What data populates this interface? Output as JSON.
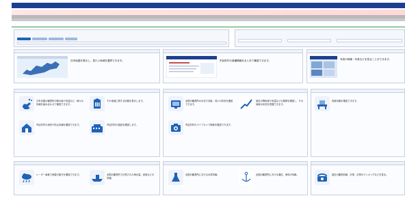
{
  "header": {
    "site_title": "",
    "alert_text": "",
    "band1_text": "",
    "band2_text": "",
    "section_title": ""
  },
  "search_panel": {
    "title": "",
    "tabs": [
      "",
      "",
      "",
      ""
    ]
  },
  "right_panel": {
    "title": "",
    "buttons": [
      "",
      "",
      ""
    ]
  },
  "thumbnails": [
    {
      "title": "",
      "desc": "日本地図を表示し、見たい地域を選択できます。"
    },
    {
      "title": "",
      "desc": "市区町村の各種情報をまとめて確認できます。"
    },
    {
      "title": "",
      "desc": "写真や映像・写真などを見ることができます。"
    }
  ],
  "main_section_label": "",
  "groups": [
    {
      "title": "",
      "cards": [
        {
          "icon": "hand-rain-icon",
          "title": "",
          "desc": "日本全国の観測所の降水量や気温など、様々な情報を組み合わせて確認できます。"
        },
        {
          "icon": "tower-icon",
          "title": "",
          "desc": "その地域に関する情報を表示します。"
        },
        {
          "icon": "house-icon",
          "title": "",
          "desc": "市区町村の地形や防災情報を確認できます。"
        },
        {
          "icon": "building-icon",
          "title": "",
          "desc": "市区町村の施設を確認します。"
        }
      ]
    },
    {
      "title": "",
      "cards": [
        {
          "icon": "tv-icon",
          "title": "",
          "desc": "全国の観測所の水位や流量、河川の状況を確認できます。"
        },
        {
          "icon": "graph-icon",
          "title": "",
          "desc": "過去の降雨量や気温などの推移を確認し、その地域の状況を把握できます。"
        },
        {
          "icon": "camera-icon",
          "title": "",
          "desc": "市区町村のライブカメラ映像を確認できます。"
        }
      ]
    },
    {
      "title": "",
      "cards": [
        {
          "icon": "desk-icon",
          "title": "",
          "desc": "気象情報を確認できます。"
        }
      ]
    },
    {
      "title": "",
      "cards": [
        {
          "icon": "cloud-icon",
          "title": "",
          "desc": "レーダー画像で雨雲の動きを確認できます。"
        },
        {
          "icon": "ship-icon",
          "title": "",
          "desc": "全国の観測所で計測された海水温、波浪などの情報。"
        }
      ]
    },
    {
      "title": "",
      "cards": [
        {
          "icon": "flask-icon",
          "title": "",
          "desc": "全国の観測所における水質情報。"
        },
        {
          "icon": "anchor-icon",
          "title": "",
          "desc": "全国の観測所における潮位、海流の情報。"
        }
      ]
    },
    {
      "title": "",
      "cards": [
        {
          "icon": "phone-icon",
          "title": "",
          "desc": "過去の観測情報、計測、計測のランキングなどを見る。"
        }
      ]
    }
  ],
  "colors": {
    "primary": "#1d3f8f",
    "accent_green": "#2f9e44",
    "alert_bg": "#ffe2e2",
    "icon_blue": "#1f63b7"
  }
}
